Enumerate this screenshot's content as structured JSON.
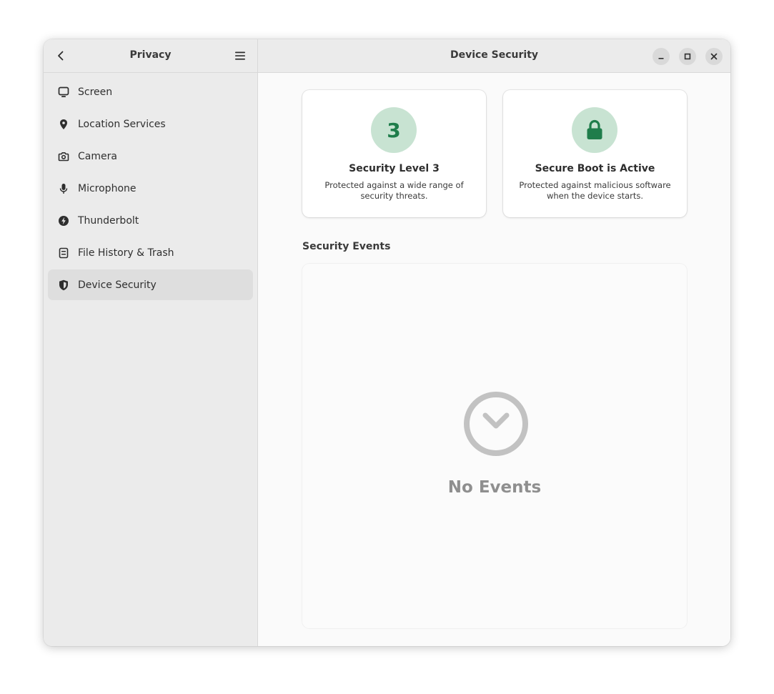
{
  "sidebar": {
    "title": "Privacy",
    "back_icon": "chevron-left-icon",
    "menu_icon": "hamburger-menu-icon",
    "items": [
      {
        "label": "Screen",
        "icon": "display-icon",
        "selected": false
      },
      {
        "label": "Location Services",
        "icon": "location-pin-icon",
        "selected": false
      },
      {
        "label": "Camera",
        "icon": "camera-icon",
        "selected": false
      },
      {
        "label": "Microphone",
        "icon": "microphone-icon",
        "selected": false
      },
      {
        "label": "Thunderbolt",
        "icon": "thunderbolt-icon",
        "selected": false
      },
      {
        "label": "File History & Trash",
        "icon": "file-history-icon",
        "selected": false
      },
      {
        "label": "Device Security",
        "icon": "shield-icon",
        "selected": true
      }
    ]
  },
  "main": {
    "title": "Device Security",
    "window_controls": {
      "minimize_icon": "minimize-icon",
      "maximize_icon": "maximize-icon",
      "close_icon": "close-icon"
    },
    "cards": [
      {
        "badge": "3",
        "title": "Security Level 3",
        "description": "Protected against a wide range of security threats."
      },
      {
        "badge_icon": "padlock-icon",
        "title": "Secure Boot is Active",
        "description": "Protected against malicious software when the device starts."
      }
    ],
    "events_section": {
      "label": "Security Events",
      "empty_icon": "clock-check-icon",
      "empty_text": "No Events"
    }
  },
  "colors": {
    "accent_green": "#1f7d4b",
    "badge_bg": "#c8e3d2",
    "sidebar_bg": "#ebebeb",
    "selected_bg": "#dedede",
    "muted_text": "#8f8f8f"
  }
}
